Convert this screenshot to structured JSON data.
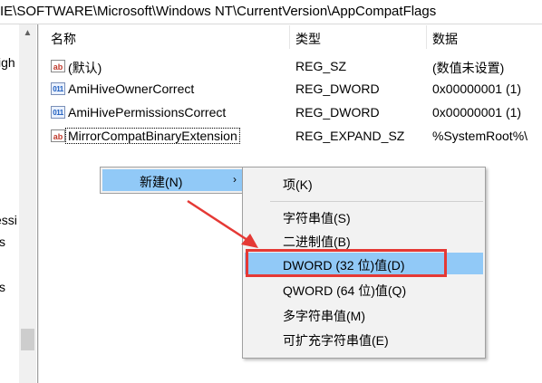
{
  "path": "IE\\SOFTWARE\\Microsoft\\Windows NT\\CurrentVersion\\AppCompatFlags",
  "tree_fragments": [
    "igh",
    "essi",
    "s",
    "s"
  ],
  "columns": {
    "name": "名称",
    "type": "类型",
    "data": "数据"
  },
  "rows": [
    {
      "icon": "ab",
      "name": "(默认)",
      "type": "REG_SZ",
      "data": "(数值未设置)"
    },
    {
      "icon": "dword",
      "name": "AmiHiveOwnerCorrect",
      "type": "REG_DWORD",
      "data": "0x00000001 (1)"
    },
    {
      "icon": "dword",
      "name": "AmiHivePermissionsCorrect",
      "type": "REG_DWORD",
      "data": "0x00000001 (1)"
    },
    {
      "icon": "ab",
      "name": "MirrorCompatBinaryExtension",
      "type": "REG_EXPAND_SZ",
      "data": "%SystemRoot%\\"
    }
  ],
  "icons": {
    "ab": "string-value-icon",
    "dword": "binary-value-icon"
  },
  "context_menu": {
    "new_label": "新建(N)",
    "submenu_arrow": "›"
  },
  "submenu": {
    "key": "项(K)",
    "string": "字符串值(S)",
    "binary": "二进制值(B)",
    "dword": "DWORD (32 位)值(D)",
    "qword": "QWORD (64 位)值(Q)",
    "multi_string": "多字符串值(M)",
    "expandable_string": "可扩充字符串值(E)"
  },
  "colors": {
    "highlight": "#91c9f7",
    "annotation": "#e53935"
  }
}
